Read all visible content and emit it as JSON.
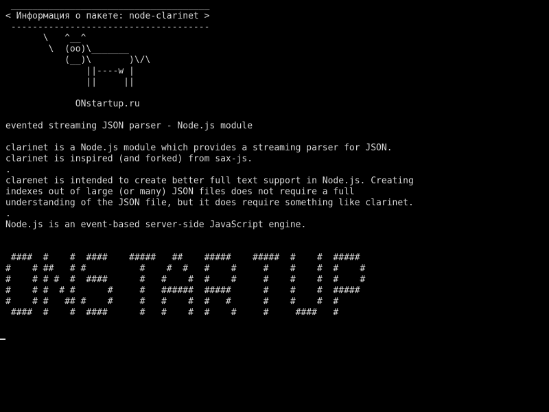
{
  "terminal": {
    "lines": [
      " _____________________________________",
      "< Информация о пакете: node-clarinet >",
      " -------------------------------------",
      "       \\   ^__^",
      "        \\  (oo)\\_______",
      "           (__)\\       )\\/\\",
      "               ||----w |",
      "               ||     ||",
      "",
      "             ONstartup.ru",
      "",
      "evented streaming JSON parser - Node.js module",
      "",
      "clarinet is a Node.js module which provides a streaming parser for JSON.",
      "clarinet is inspired (and forked) from sax-js.",
      ".",
      "clarenet is intended to create better full text support in Node.js. Creating",
      "indexes out of large (or many) JSON files does not require a full",
      "understanding of the JSON file, but it does require something like clarinet.",
      ".",
      "Node.js is an event-based server-side JavaScript engine.",
      "",
      "",
      " ####  #    #  ####    #####   ##    #####    #####  #    #  #####",
      "#    # ##   # #          #    #  #   #    #     #    #    #  #    #",
      "#    # # #  #  ####      #   #    #  #    #     #    #    #  #    #",
      "#    # #  # #      #     #   ######  #####      #    #    #  #####",
      "#    # #   ## #    #     #   #    #  #   #      #    #    #  #",
      " ####  #    #  ####      #   #    #  #    #     #     ####   #"
    ]
  }
}
